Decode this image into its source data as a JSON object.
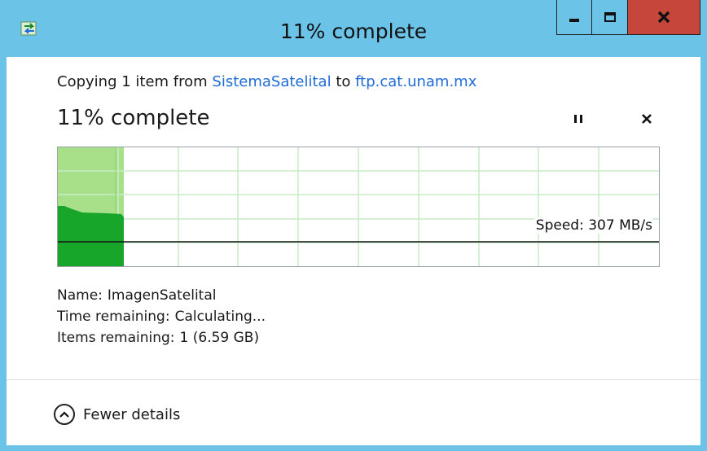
{
  "window": {
    "title": "11% complete",
    "app_icon": "copy-arrows-icon",
    "controls": {
      "minimize": "minimize-icon",
      "maximize": "maximize-icon",
      "close": "close-icon"
    },
    "colors": {
      "titlebar": "#6cc3e8",
      "close_button": "#c7463c"
    }
  },
  "copy": {
    "prefix": "Copying 1 item from",
    "source": "SistemaSatelital",
    "connector": "to",
    "destination": "ftp.cat.unam.mx",
    "progress_title": "11% complete",
    "progress_fraction": 0.11,
    "pause_icon": "pause-icon",
    "cancel_icon": "cancel-x-icon"
  },
  "graph": {
    "speed_label": "Speed: 307 MB/s",
    "colors": {
      "progress_light": "#a8e08a",
      "progress_dark": "#17a52a",
      "grid": "#c7ecc7"
    }
  },
  "details": {
    "name_label": "Name:",
    "name_value": "ImagenSatelital",
    "time_label": "Time remaining:",
    "time_value": "Calculating...",
    "items_label": "Items remaining:",
    "items_value": "1 (6.59 GB)"
  },
  "footer": {
    "toggle_label": "Fewer details",
    "toggle_icon": "chevron-up-circle-icon"
  }
}
